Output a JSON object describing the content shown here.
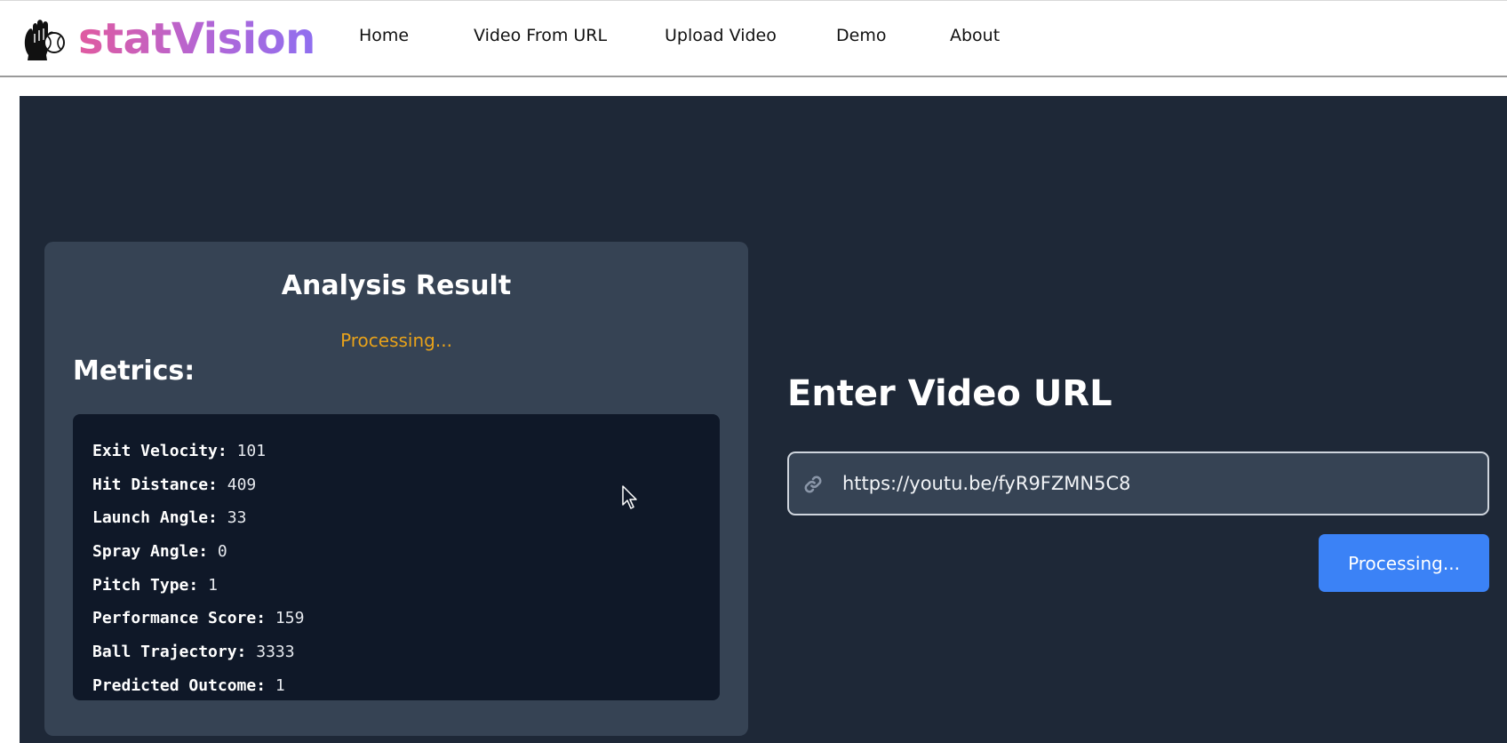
{
  "brand": {
    "name": "statVision",
    "logo_icon": "baseball-glove-icon"
  },
  "nav": {
    "items": [
      {
        "label": "Home"
      },
      {
        "label": "Video From URL"
      },
      {
        "label": "Upload Video"
      },
      {
        "label": "Demo"
      },
      {
        "label": "About"
      }
    ]
  },
  "result": {
    "title": "Analysis Result",
    "status": "Processing...",
    "metrics_heading": "Metrics:",
    "metrics": [
      {
        "label": "Exit Velocity:",
        "value": "101"
      },
      {
        "label": "Hit Distance:",
        "value": "409"
      },
      {
        "label": "Launch Angle:",
        "value": "33"
      },
      {
        "label": "Spray Angle:",
        "value": "0"
      },
      {
        "label": "Pitch Type:",
        "value": "1"
      },
      {
        "label": "Performance Score:",
        "value": "159"
      },
      {
        "label": "Ball Trajectory:",
        "value": "3333"
      },
      {
        "label": "Predicted Outcome:",
        "value": "1"
      }
    ]
  },
  "url_form": {
    "heading": "Enter Video URL",
    "input_value": "https://youtu.be/fyR9FZMN5C8",
    "input_icon": "link-icon",
    "button_label": "Processing..."
  },
  "colors": {
    "brand_gradient_start": "#e05aa0",
    "brand_gradient_end": "#8f6ff0",
    "panel_bg": "#1e2837",
    "card_bg": "#364354",
    "metrics_bg": "#0f1828",
    "status": "#e8a21a",
    "button": "#3b82f6"
  }
}
